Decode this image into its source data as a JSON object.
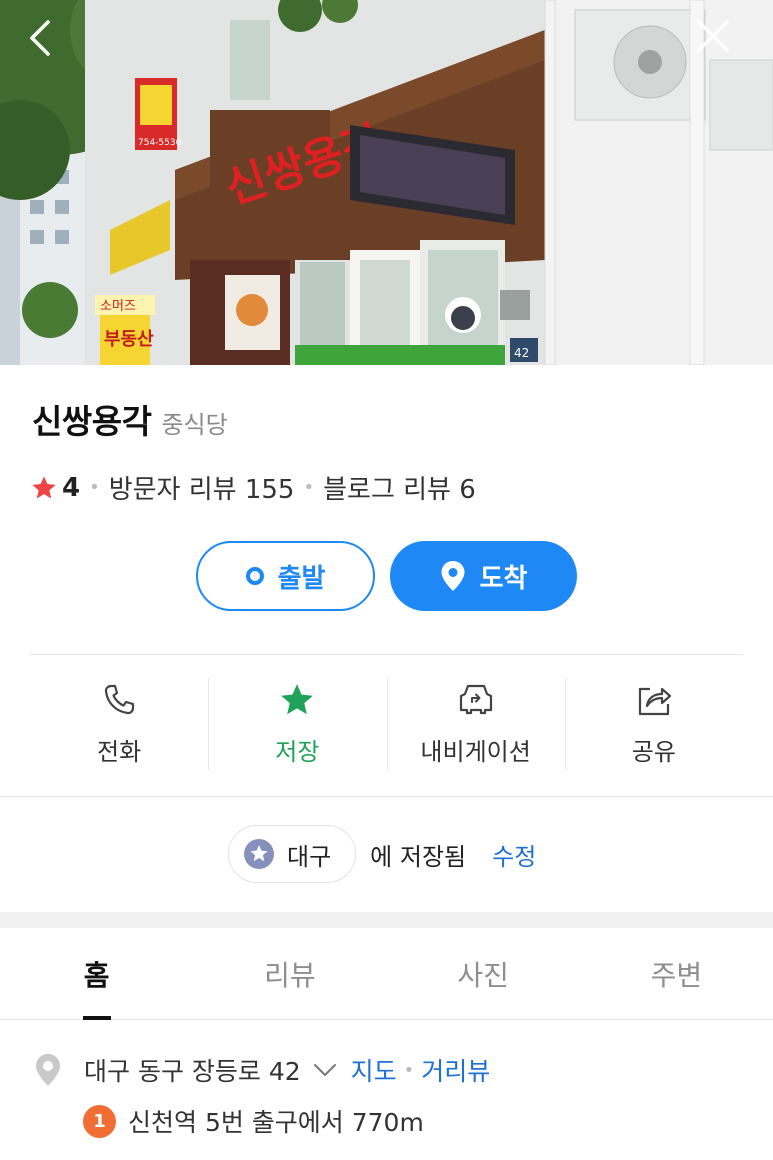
{
  "header": {
    "back_icon": "chevron-left-icon",
    "close_icon": "close-icon",
    "photo": {
      "sign_main": "신쌍용각",
      "sign_side": "소머즈",
      "sign_side2": "부동산",
      "sign_number": "754-5536",
      "address_plate": "42"
    }
  },
  "place": {
    "name": "신쌍용각",
    "category": "중식당"
  },
  "rating": {
    "score": "4",
    "visitor_reviews": "방문자 리뷰 155",
    "blog_reviews": "블로그 리뷰 6",
    "star_color": "#f04444"
  },
  "route": {
    "depart_label": "출발",
    "arrive_label": "도착",
    "accent": "#1e88f5"
  },
  "actions": [
    {
      "label": "전화",
      "icon": "phone-icon"
    },
    {
      "label": "저장",
      "icon": "star-icon"
    },
    {
      "label": "내비게이션",
      "icon": "car-navigation-icon"
    },
    {
      "label": "공유",
      "icon": "share-icon"
    }
  ],
  "saved": {
    "folder": "대구",
    "text": "에 저장됨",
    "edit_label": "수정"
  },
  "tabs": [
    {
      "label": "홈",
      "active": true
    },
    {
      "label": "리뷰",
      "active": false
    },
    {
      "label": "사진",
      "active": false
    },
    {
      "label": "주변",
      "active": false
    }
  ],
  "address": {
    "text": "대구 동구 장등로 42",
    "map_link": "지도",
    "street_view_link": "거리뷰",
    "station_line": "1",
    "station_text": "신천역 5번 출구에서 770m",
    "line_color": "#f26d33"
  }
}
